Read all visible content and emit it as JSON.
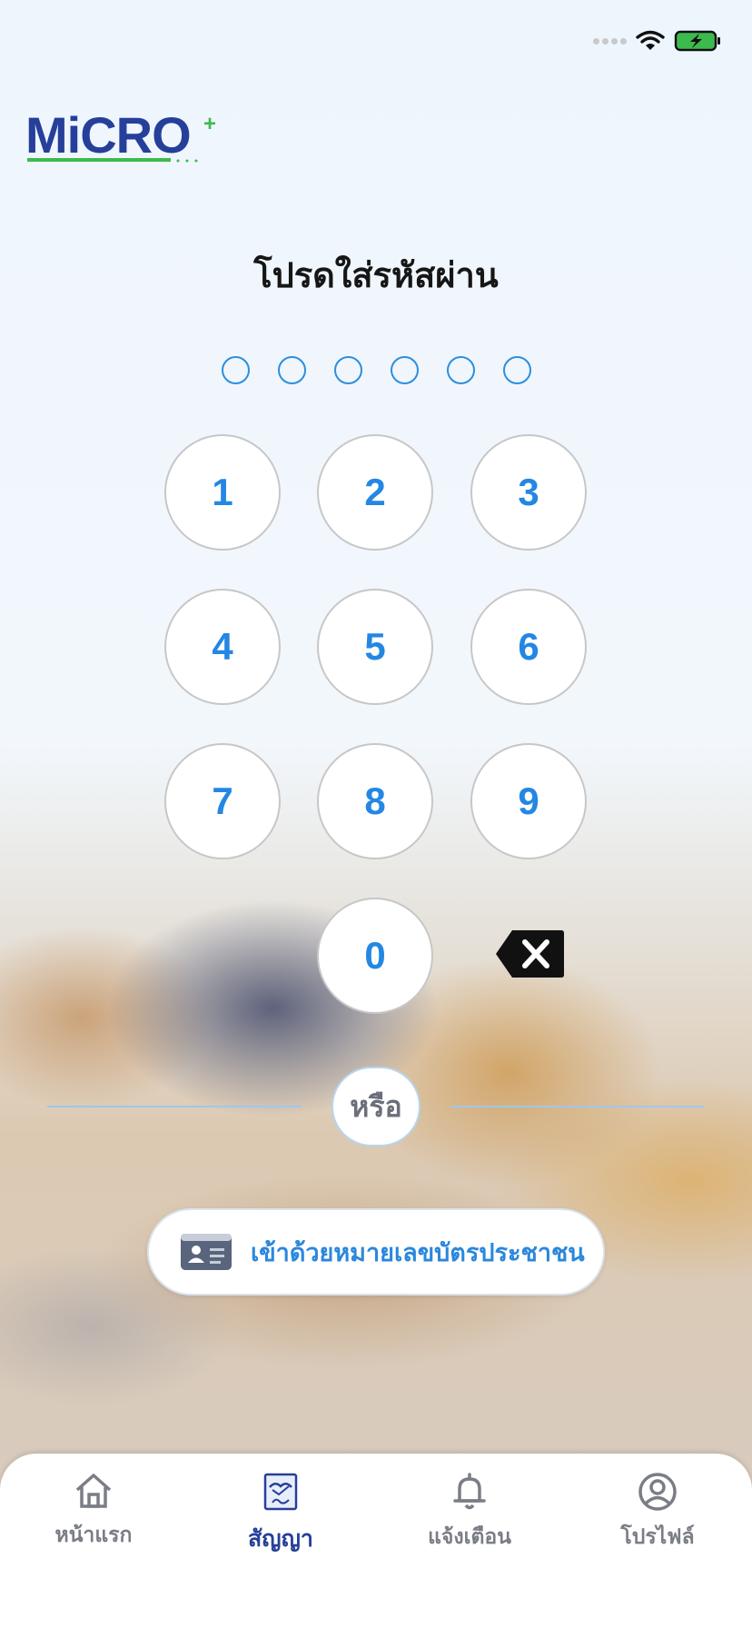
{
  "brand": {
    "logo_text": "MiCRO",
    "logo_plus": "+"
  },
  "pin": {
    "title": "โปรดใส่รหัสผ่าน",
    "length": 6,
    "keys": [
      "1",
      "2",
      "3",
      "4",
      "5",
      "6",
      "7",
      "8",
      "9",
      "0"
    ]
  },
  "separator": {
    "label": "หรือ"
  },
  "id_login": {
    "label": "เข้าด้วยหมายเลขบัตรประชาชน",
    "icon": "id-card-icon"
  },
  "tabbar": {
    "items": [
      {
        "label": "หน้าแรก",
        "icon": "home-icon",
        "active": false
      },
      {
        "label": "สัญญา",
        "icon": "contract-icon",
        "active": true
      },
      {
        "label": "แจ้งเตือน",
        "icon": "bell-icon",
        "active": false
      },
      {
        "label": "โปรไฟล์",
        "icon": "profile-icon",
        "active": false
      }
    ]
  },
  "status_bar": {
    "icons": [
      "signal-icon",
      "wifi-icon",
      "battery-charging-icon"
    ]
  },
  "colors": {
    "accent": "#2387e3",
    "brand_navy": "#263f9a",
    "brand_green": "#3dba4e",
    "pin_dot": "#2b8fe0"
  }
}
